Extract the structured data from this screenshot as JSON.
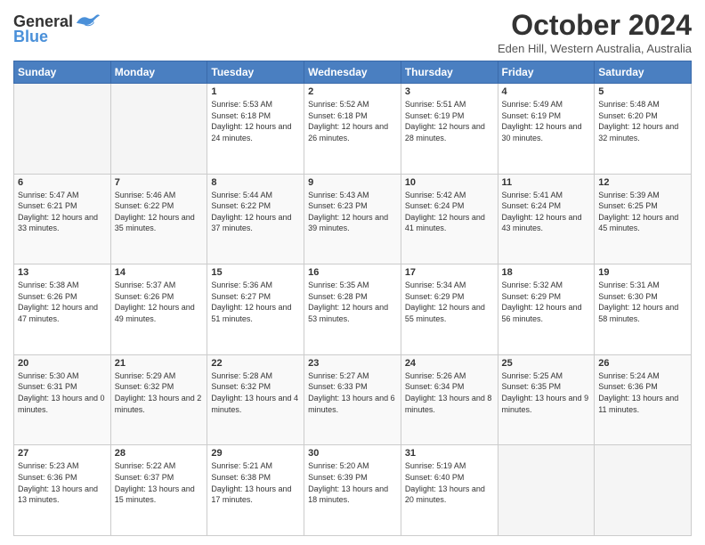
{
  "header": {
    "logo_line1": "General",
    "logo_line2": "Blue",
    "month_title": "October 2024",
    "subtitle": "Eden Hill, Western Australia, Australia"
  },
  "weekdays": [
    "Sunday",
    "Monday",
    "Tuesday",
    "Wednesday",
    "Thursday",
    "Friday",
    "Saturday"
  ],
  "weeks": [
    [
      {
        "day": "",
        "empty": true
      },
      {
        "day": "",
        "empty": true
      },
      {
        "day": "1",
        "sunrise": "5:53 AM",
        "sunset": "6:18 PM",
        "daylight": "12 hours and 24 minutes."
      },
      {
        "day": "2",
        "sunrise": "5:52 AM",
        "sunset": "6:18 PM",
        "daylight": "12 hours and 26 minutes."
      },
      {
        "day": "3",
        "sunrise": "5:51 AM",
        "sunset": "6:19 PM",
        "daylight": "12 hours and 28 minutes."
      },
      {
        "day": "4",
        "sunrise": "5:49 AM",
        "sunset": "6:19 PM",
        "daylight": "12 hours and 30 minutes."
      },
      {
        "day": "5",
        "sunrise": "5:48 AM",
        "sunset": "6:20 PM",
        "daylight": "12 hours and 32 minutes."
      }
    ],
    [
      {
        "day": "6",
        "sunrise": "5:47 AM",
        "sunset": "6:21 PM",
        "daylight": "12 hours and 33 minutes."
      },
      {
        "day": "7",
        "sunrise": "5:46 AM",
        "sunset": "6:22 PM",
        "daylight": "12 hours and 35 minutes."
      },
      {
        "day": "8",
        "sunrise": "5:44 AM",
        "sunset": "6:22 PM",
        "daylight": "12 hours and 37 minutes."
      },
      {
        "day": "9",
        "sunrise": "5:43 AM",
        "sunset": "6:23 PM",
        "daylight": "12 hours and 39 minutes."
      },
      {
        "day": "10",
        "sunrise": "5:42 AM",
        "sunset": "6:24 PM",
        "daylight": "12 hours and 41 minutes."
      },
      {
        "day": "11",
        "sunrise": "5:41 AM",
        "sunset": "6:24 PM",
        "daylight": "12 hours and 43 minutes."
      },
      {
        "day": "12",
        "sunrise": "5:39 AM",
        "sunset": "6:25 PM",
        "daylight": "12 hours and 45 minutes."
      }
    ],
    [
      {
        "day": "13",
        "sunrise": "5:38 AM",
        "sunset": "6:26 PM",
        "daylight": "12 hours and 47 minutes."
      },
      {
        "day": "14",
        "sunrise": "5:37 AM",
        "sunset": "6:26 PM",
        "daylight": "12 hours and 49 minutes."
      },
      {
        "day": "15",
        "sunrise": "5:36 AM",
        "sunset": "6:27 PM",
        "daylight": "12 hours and 51 minutes."
      },
      {
        "day": "16",
        "sunrise": "5:35 AM",
        "sunset": "6:28 PM",
        "daylight": "12 hours and 53 minutes."
      },
      {
        "day": "17",
        "sunrise": "5:34 AM",
        "sunset": "6:29 PM",
        "daylight": "12 hours and 55 minutes."
      },
      {
        "day": "18",
        "sunrise": "5:32 AM",
        "sunset": "6:29 PM",
        "daylight": "12 hours and 56 minutes."
      },
      {
        "day": "19",
        "sunrise": "5:31 AM",
        "sunset": "6:30 PM",
        "daylight": "12 hours and 58 minutes."
      }
    ],
    [
      {
        "day": "20",
        "sunrise": "5:30 AM",
        "sunset": "6:31 PM",
        "daylight": "13 hours and 0 minutes."
      },
      {
        "day": "21",
        "sunrise": "5:29 AM",
        "sunset": "6:32 PM",
        "daylight": "13 hours and 2 minutes."
      },
      {
        "day": "22",
        "sunrise": "5:28 AM",
        "sunset": "6:32 PM",
        "daylight": "13 hours and 4 minutes."
      },
      {
        "day": "23",
        "sunrise": "5:27 AM",
        "sunset": "6:33 PM",
        "daylight": "13 hours and 6 minutes."
      },
      {
        "day": "24",
        "sunrise": "5:26 AM",
        "sunset": "6:34 PM",
        "daylight": "13 hours and 8 minutes."
      },
      {
        "day": "25",
        "sunrise": "5:25 AM",
        "sunset": "6:35 PM",
        "daylight": "13 hours and 9 minutes."
      },
      {
        "day": "26",
        "sunrise": "5:24 AM",
        "sunset": "6:36 PM",
        "daylight": "13 hours and 11 minutes."
      }
    ],
    [
      {
        "day": "27",
        "sunrise": "5:23 AM",
        "sunset": "6:36 PM",
        "daylight": "13 hours and 13 minutes."
      },
      {
        "day": "28",
        "sunrise": "5:22 AM",
        "sunset": "6:37 PM",
        "daylight": "13 hours and 15 minutes."
      },
      {
        "day": "29",
        "sunrise": "5:21 AM",
        "sunset": "6:38 PM",
        "daylight": "13 hours and 17 minutes."
      },
      {
        "day": "30",
        "sunrise": "5:20 AM",
        "sunset": "6:39 PM",
        "daylight": "13 hours and 18 minutes."
      },
      {
        "day": "31",
        "sunrise": "5:19 AM",
        "sunset": "6:40 PM",
        "daylight": "13 hours and 20 minutes."
      },
      {
        "day": "",
        "empty": true
      },
      {
        "day": "",
        "empty": true
      }
    ]
  ]
}
